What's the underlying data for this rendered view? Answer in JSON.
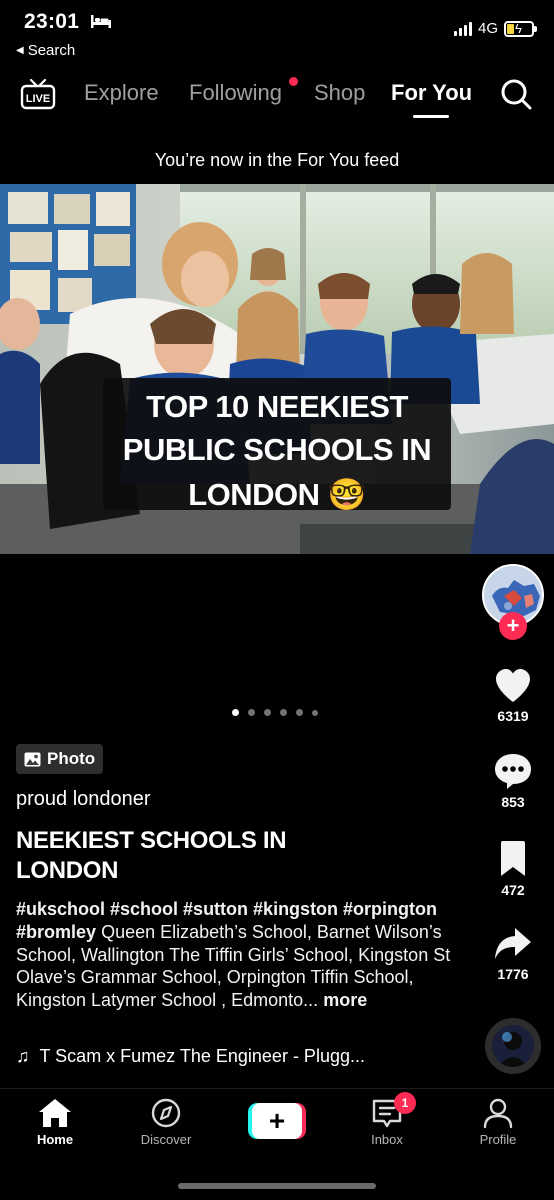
{
  "status_bar": {
    "time": "23:01",
    "back_label": "Search",
    "network": "4G",
    "battery_level": 0.3,
    "icons": [
      "bed-icon",
      "signal-icon",
      "battery-charging-icon"
    ]
  },
  "top_nav": {
    "live_icon": "live-tv-icon",
    "tabs": [
      {
        "label": "Explore",
        "active": false
      },
      {
        "label": "Following",
        "active": false,
        "notification_dot": true
      },
      {
        "label": "Shop",
        "active": false
      },
      {
        "label": "For You",
        "active": true
      }
    ],
    "search_icon": "search-icon"
  },
  "feed_notice": "You’re now in the For You feed",
  "post": {
    "photo_caption_lines": [
      "TOP 10 NEEKIEST",
      "PUBLIC SCHOOLS IN",
      "LONDON 🤓"
    ],
    "carousel": {
      "count": 6,
      "active_index": 0
    },
    "badge": "Photo",
    "username": "proud londoner",
    "title": "NEEKIEST SCHOOLS IN LONDON",
    "hashtags": "#ukschool #school #sutton #kingston #orpington #bromley",
    "description": "Queen Elizabeth’s School, Barnet  Wilson’s School, Wallington The Tiffin Girls’ School, Kingston  St Olave’s Grammar School, Orpington  Tiffin School, Kingston  Latymer School , Edmonto...",
    "more_label": "more",
    "music": "T Scam x Fumez The Engineer - Plugg..."
  },
  "actions": {
    "likes": "6319",
    "comments": "853",
    "saves": "472",
    "shares": "1776"
  },
  "bottom_nav": {
    "items": [
      {
        "label": "Home",
        "icon": "home-icon",
        "active": true
      },
      {
        "label": "Discover",
        "icon": "compass-icon",
        "active": false
      },
      {
        "label": "",
        "icon": "create-plus-icon",
        "active": false
      },
      {
        "label": "Inbox",
        "icon": "inbox-icon",
        "active": false,
        "badge": "1"
      },
      {
        "label": "Profile",
        "icon": "profile-icon",
        "active": false
      }
    ]
  },
  "colors": {
    "accent": "#fe2c55",
    "cyan": "#25f4ee",
    "background": "#000000"
  }
}
